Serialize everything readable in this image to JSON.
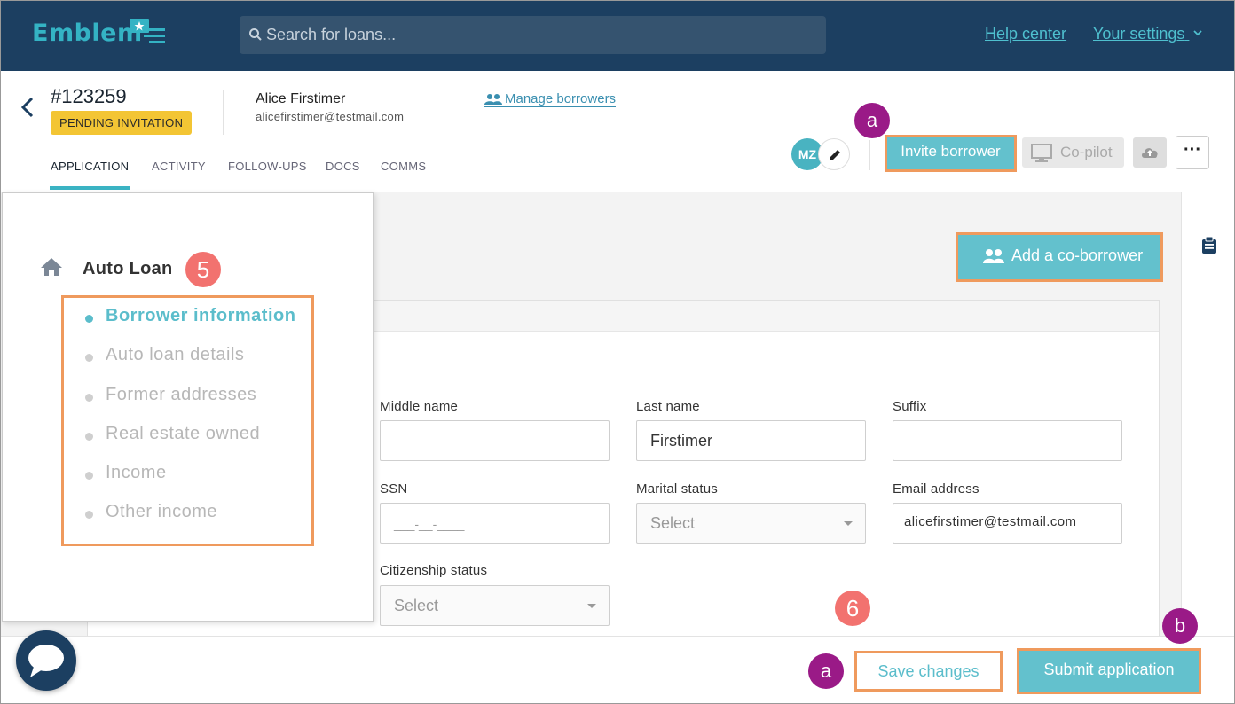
{
  "app": {
    "logo": "Emblem"
  },
  "search": {
    "placeholder": "Search for loans..."
  },
  "topnav": {
    "help": "Help center",
    "settings": "Your settings"
  },
  "loan": {
    "id": "#123259",
    "status": "PENDING INVITATION",
    "borrower_name": "Alice Firstimer",
    "borrower_email": "alicefirstimer@testmail.com",
    "manage": "Manage borrowers"
  },
  "tabs": [
    "APPLICATION",
    "ACTIVITY",
    "FOLLOW-UPS",
    "DOCS",
    "COMMS"
  ],
  "actions": {
    "avatar": "MZ",
    "invite": "Invite borrower",
    "copilot": "Co-pilot",
    "add_coborrower": "Add a co-borrower"
  },
  "markers": {
    "a": "a",
    "b": "b",
    "five": "5",
    "six": "6"
  },
  "sidebar": {
    "section": "Auto Loan",
    "items": [
      {
        "label": "Borrower information",
        "active": true
      },
      {
        "label": "Auto loan details",
        "active": false
      },
      {
        "label": "Former addresses",
        "active": false
      },
      {
        "label": "Real estate owned",
        "active": false
      },
      {
        "label": "Income",
        "active": false
      },
      {
        "label": "Other income",
        "active": false
      }
    ]
  },
  "form": {
    "middle_name": {
      "label": "Middle name",
      "value": ""
    },
    "last_name": {
      "label": "Last name",
      "value": "Firstimer"
    },
    "suffix": {
      "label": "Suffix",
      "value": ""
    },
    "ssn": {
      "label": "SSN",
      "value": "___-__-____"
    },
    "marital": {
      "label": "Marital status",
      "value": "Select"
    },
    "email": {
      "label": "Email address",
      "value": "alicefirstimer@testmail.com"
    },
    "citizenship": {
      "label": "Citizenship status",
      "value": "Select"
    }
  },
  "footer": {
    "save": "Save changes",
    "submit": "Submit application"
  },
  "colors": {
    "navy": "#1c3f61",
    "teal": "#63c1cd",
    "highlight": "#ef9a5d",
    "marker_purple": "#9a1a87",
    "marker_salmon": "#f2726f",
    "badge": "#f3c534"
  }
}
